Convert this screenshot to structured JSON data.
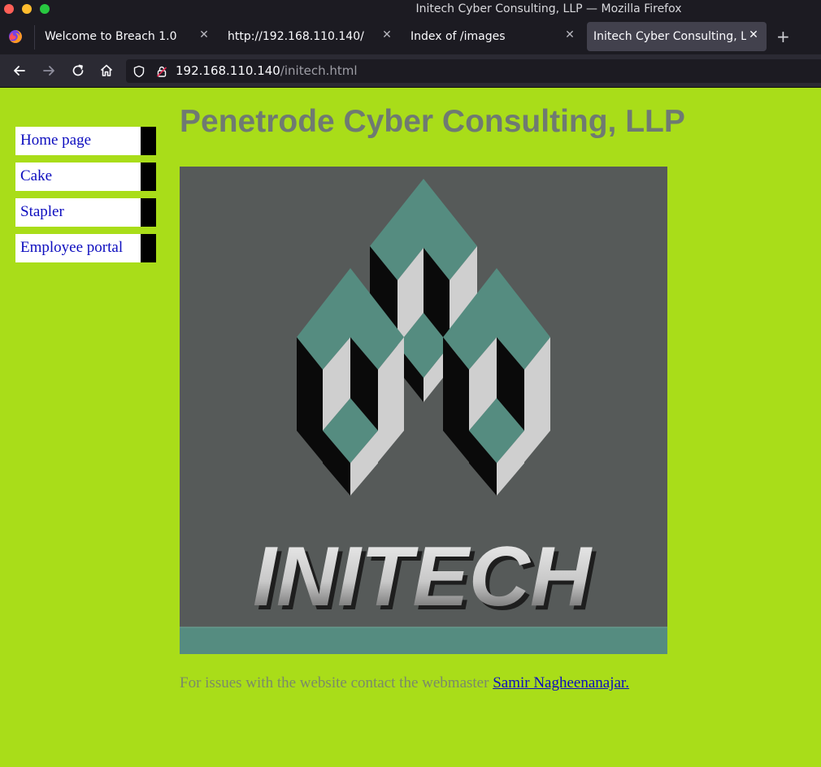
{
  "window": {
    "title": "Initech Cyber Consulting, LLP — Mozilla Firefox"
  },
  "tabs": [
    {
      "label": "Welcome to Breach 1.0",
      "active": false
    },
    {
      "label": "http://192.168.110.140/",
      "active": false
    },
    {
      "label": "Index of /images",
      "active": false
    },
    {
      "label": "Initech Cyber Consulting, LLP",
      "active": true
    }
  ],
  "urlbar": {
    "host": "192.168.110.140",
    "path": "/initech.html"
  },
  "icons": {
    "browser": "firefox-icon",
    "back": "back-arrow-icon",
    "forward": "forward-arrow-icon",
    "reload": "reload-icon",
    "home": "home-icon",
    "shield": "shield-icon",
    "lock": "insecure-lock-icon",
    "new_tab": "plus-icon",
    "tab_close": "close-icon"
  },
  "sidebar": {
    "items": [
      {
        "label": "Home page"
      },
      {
        "label": "Cake"
      },
      {
        "label": "Stapler"
      },
      {
        "label": "Employee portal"
      }
    ]
  },
  "main": {
    "title": "Penetrode Cyber Consulting, LLP",
    "logo_text": "INITECH",
    "footer_text": "For issues with the website contact the webmaster ",
    "footer_link": "Samir Nagheenanajar."
  },
  "colors": {
    "page_bg": "#a9dd19",
    "title": "#6f7a72",
    "link": "#0d0dbf",
    "logo_bg": "#565a59",
    "logo_teal": "#558c80"
  }
}
